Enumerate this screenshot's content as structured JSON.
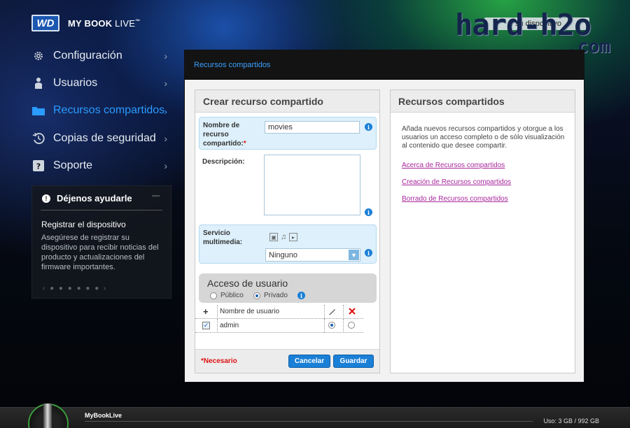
{
  "header": {
    "brand_mark": "WD",
    "product_name_bold": "MY BOOK",
    "product_name_light": "LIVE",
    "product_tm": "™",
    "device_button": "su dispositivo",
    "watermark_line1": "hard-h2o",
    "watermark_line2": ".com"
  },
  "nav": [
    {
      "label": "Configuración",
      "icon": "gear-icon",
      "active": false
    },
    {
      "label": "Usuarios",
      "icon": "user-icon",
      "active": false
    },
    {
      "label": "Recursos compartidos",
      "icon": "folder-icon",
      "active": true
    },
    {
      "label": "Copias de seguridad",
      "icon": "history-icon",
      "active": false
    },
    {
      "label": "Soporte",
      "icon": "help-icon",
      "active": false
    }
  ],
  "help": {
    "heading": "Déjenos ayudarle",
    "more": "\"\"\"",
    "title": "Registrar el dispositivo",
    "text": "Asegúrese de registrar su dispositivo para recibir noticias del producto y actualizaciones del firmware importantes.",
    "pager": "‹ ● ● ● ● ● ● ›"
  },
  "panel": {
    "title": "Recursos compartidos"
  },
  "create": {
    "title": "Crear recurso compartido",
    "name_label": "Nombre de recurso compartido:",
    "name_required_mark": "*",
    "name_value": "movies",
    "description_label": "Descripción:",
    "description_value": "",
    "media_label": "Servicio multimedia:",
    "media_selected": "Ninguno",
    "access_title": "Acceso de usuario",
    "access_public": "Público",
    "access_private": "Privado",
    "access_selected": "Privado",
    "table_add_symbol": "+",
    "table_header_user": "Nombre de usuario",
    "users": [
      {
        "name": "admin",
        "checked": true,
        "full_access": true,
        "read_only": false
      }
    ],
    "required_note": "*Necesario",
    "cancel_label": "Cancelar",
    "save_label": "Guardar"
  },
  "shares": {
    "title": "Recursos compartidos",
    "intro": "Añada nuevos recursos compartidos y otorgue a los usuarios un acceso completo o de sólo visualización al contenido que desee compartir.",
    "links": [
      "Acerca de Recursos compartidos",
      "Creación de Recursos compartidos",
      "Borrado de Recursos compartidos"
    ]
  },
  "footer": {
    "device_name": "MyBookLive",
    "usage_label": "Uso:",
    "usage_value": "3 GB / 992 GB"
  },
  "colors": {
    "accent": "#2a9bff",
    "button": "#1a7fd6",
    "link": "#a8289c",
    "required": "#dd1111"
  }
}
